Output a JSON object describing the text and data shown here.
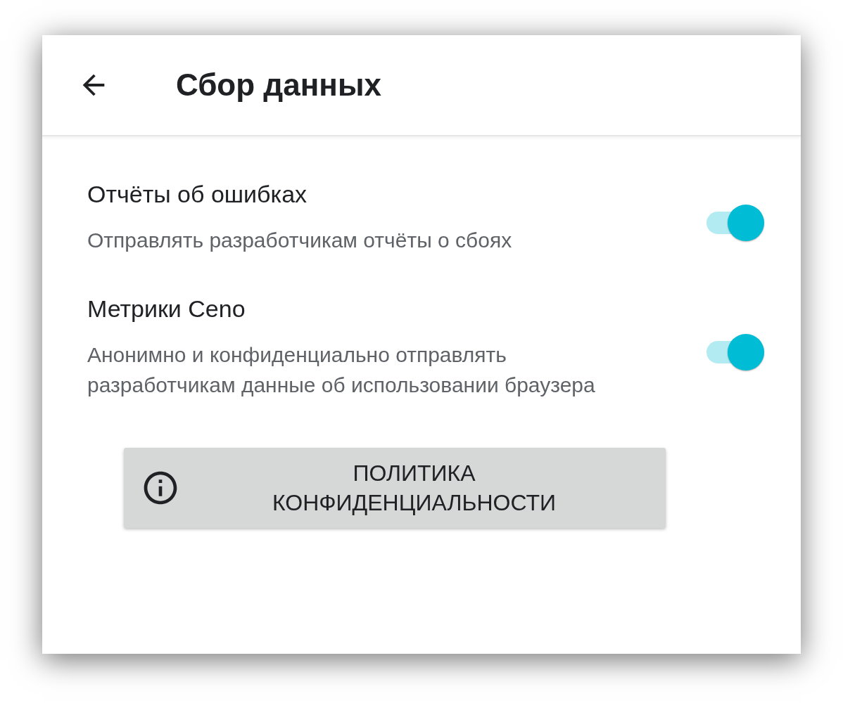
{
  "header": {
    "title": "Сбор данных"
  },
  "settings": [
    {
      "title": "Отчёты об ошибках",
      "description": "Отправлять разработчикам отчёты о сбоях",
      "on": true
    },
    {
      "title": "Метрики Ceno",
      "description": "Анонимно и конфиденциально отправлять разработчикам данные об использовании браузера",
      "on": true
    }
  ],
  "policy_button": {
    "label": "ПОЛИТИКА КОНФИДЕНЦИАЛЬНОСТИ"
  }
}
